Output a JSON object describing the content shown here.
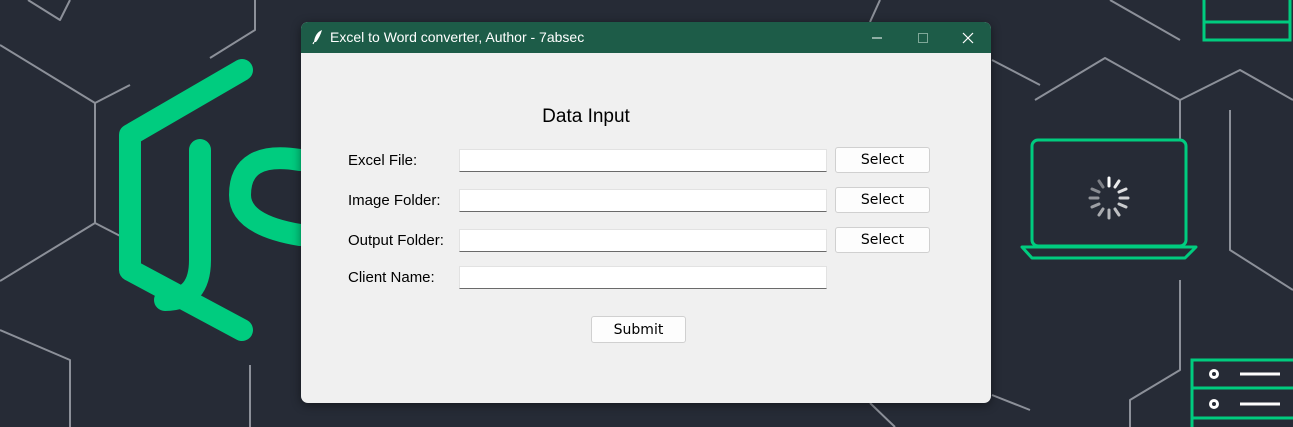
{
  "window": {
    "title": "Excel to Word converter, Author - 7absec",
    "heading": "Data Input"
  },
  "form": {
    "fields": [
      {
        "label": "Excel File:",
        "value": "",
        "button": "Select"
      },
      {
        "label": "Image Folder:",
        "value": "",
        "button": "Select"
      },
      {
        "label": "Output Folder:",
        "value": "",
        "button": "Select"
      },
      {
        "label": "Client Name:",
        "value": ""
      }
    ],
    "submit_label": "Submit"
  },
  "wallpaper": {
    "logo_text": "JS",
    "accent_color": "#00cc7f",
    "background_color": "#262b36"
  },
  "colors": {
    "titlebar": "#1d5c48",
    "window_bg": "#f0f0f0"
  }
}
